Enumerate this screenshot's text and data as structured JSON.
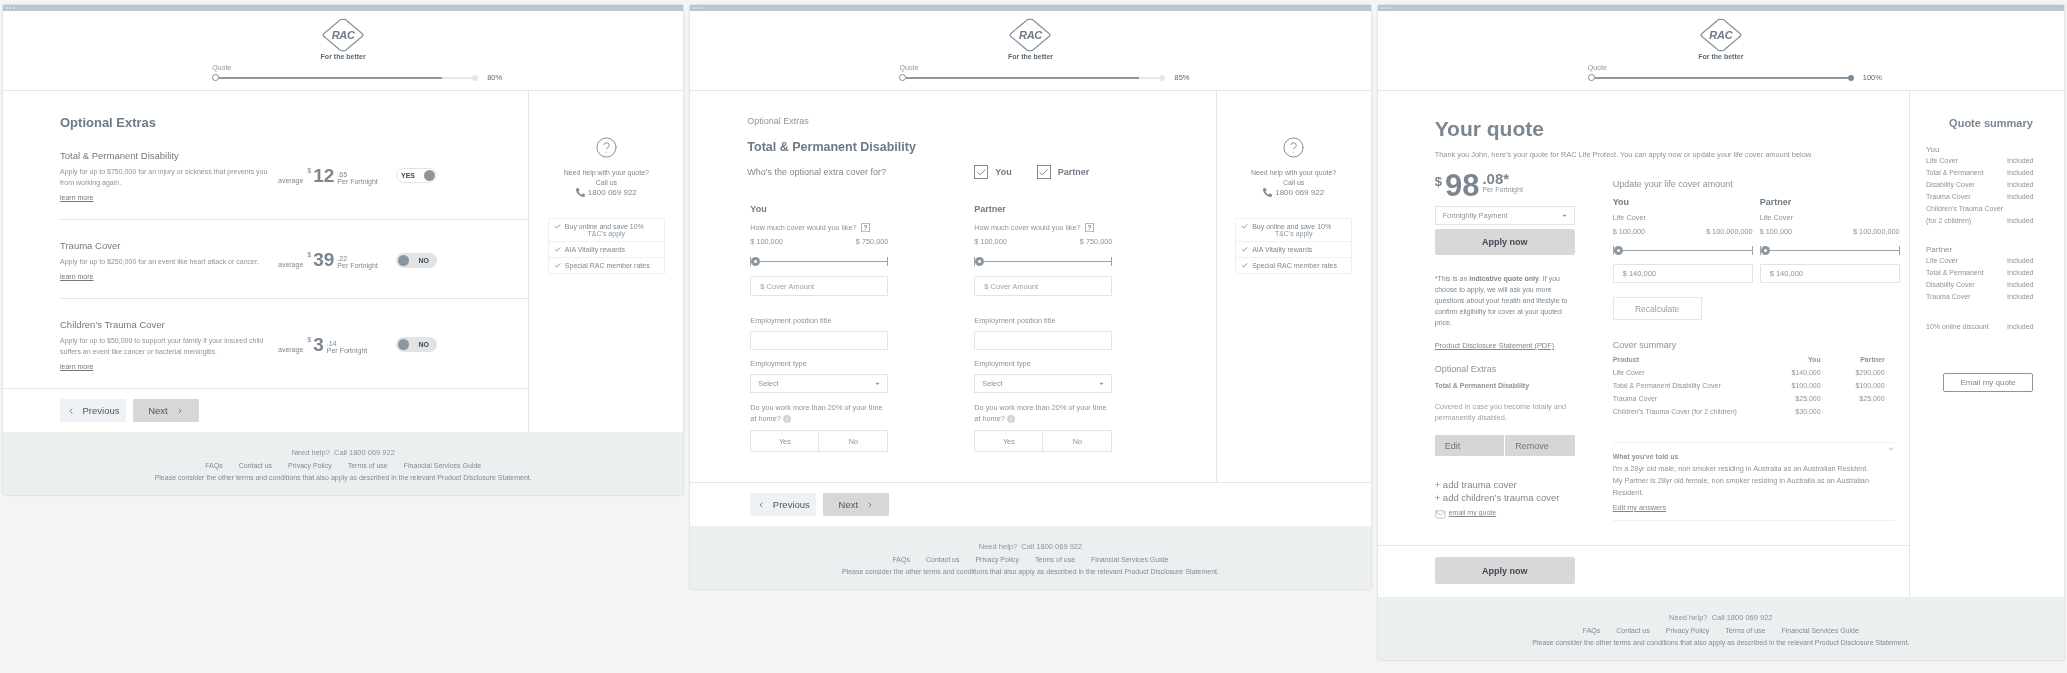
{
  "panels": [
    {
      "kind": "extras_list",
      "logo": {
        "mark": "RAC",
        "tagline": "For the better"
      },
      "progress": {
        "label": "Quote",
        "level": 0.88,
        "reading": "80%"
      },
      "title": "Optional Extras",
      "extras": [
        {
          "name": "Total & Permanent Disability",
          "description": "Apply for up to $750,000 for an injury or sickness that prevents you from working again.",
          "link": "learn more",
          "average": "average",
          "currency": "$",
          "dollars": "12",
          "cents": ".65",
          "period": "Per Fortnight",
          "toggle": "YES",
          "on": true
        },
        {
          "name": "Trauma Cover",
          "description": "Apply for up to $250,000 for an event like heart attack or cancer.",
          "link": "learn more",
          "average": "average",
          "currency": "$",
          "dollars": "39",
          "cents": ".22",
          "period": "Per Fortnight",
          "toggle": "NO",
          "on": false
        },
        {
          "name": "Children's Trauma Cover",
          "description": "Apply for up to $50,000 to support your family if your insured child suffers an event like cancer or bacterial meningitis.",
          "link": "learn more",
          "average": "average",
          "currency": "$",
          "dollars": "3",
          "cents": ".14",
          "period": "Per Fortnight",
          "toggle": "NO",
          "on": false
        }
      ],
      "nav": {
        "previous": "Previous",
        "next": "Next"
      },
      "help": {
        "question": "Need help with your quote?",
        "call": "Call us",
        "phone": "1800 069 922",
        "benefits": [
          {
            "text": "Buy online and save 10%",
            "note": "T&C's apply"
          },
          {
            "text": "AIA Vitality rewards"
          },
          {
            "text": "Special RAC member rates"
          }
        ]
      },
      "footer": {
        "help": "Need help?  Call 1800 069 922",
        "links": [
          "FAQs",
          "Contact us",
          "Privacy Policy",
          "Terms of use",
          "Financial Services Guide"
        ],
        "disclaimer": "Please consider the other terms and conditions that also apply as described in the relevant Product Disclosure Statement."
      }
    },
    {
      "kind": "extras_form",
      "logo": {
        "mark": "RAC",
        "tagline": "For the better"
      },
      "progress": {
        "label": "Quote",
        "level": 0.92,
        "reading": "85%"
      },
      "section": "Optional Extras",
      "title": "Total & Permanent Disability",
      "question": "Who's the optional extra cover for?",
      "covered": [
        {
          "label": "You",
          "checked": true
        },
        {
          "label": "Partner",
          "checked": true
        }
      ],
      "people": [
        {
          "heading": "You",
          "cover_question": "How much cover would you like?",
          "min": "$ 100,000",
          "max": "$ 750,000",
          "level": 0,
          "amount_placeholder": "$ Cover Amount",
          "position_label": "Employment position title",
          "type_label": "Employment type",
          "type_placeholder": "Select",
          "home_question": "Do you work more than 20% of your time at home?",
          "options": [
            {
              "label": "Yes",
              "selected": false
            },
            {
              "label": "No",
              "selected": false
            }
          ]
        },
        {
          "heading": "Partner",
          "cover_question": "How much cover would you like?",
          "min": "$ 100,000",
          "max": "$ 750,000",
          "level": 0,
          "amount_placeholder": "$ Cover Amount",
          "position_label": "Employment position title",
          "type_label": "Employment type",
          "type_placeholder": "Select",
          "home_question": "Do you work more than 20% of your time at home?",
          "options": [
            {
              "label": "Yes",
              "selected": false
            },
            {
              "label": "No",
              "selected": false
            }
          ]
        }
      ],
      "nav": {
        "previous": "Previous",
        "next": "Next"
      },
      "help": {
        "question": "Need help with your quote?",
        "call": "Call us",
        "phone": "1800 069 922",
        "benefits": [
          {
            "text": "Buy online and save 10%",
            "note": "T&C's apply"
          },
          {
            "text": "AIA Vitality rewards"
          },
          {
            "text": "Special RAC member rates"
          }
        ]
      },
      "footer": {
        "help": "Need help?  Call 1800 069 922",
        "links": [
          "FAQs",
          "Contact us",
          "Privacy Policy",
          "Terms of use",
          "Financial Services Guide"
        ],
        "disclaimer": "Please consider the other terms and conditions that also apply as described in the relevant Product Disclosure Statement."
      }
    },
    {
      "kind": "quote",
      "logo": {
        "mark": "RAC",
        "tagline": "For the better"
      },
      "progress": {
        "label": "Quote",
        "level": 1,
        "reading": "100%"
      },
      "title": "Your quote",
      "intro": "Thank you John, here's your quote for RAC Life Protect. You can apply now or update your life cover amount below.",
      "price": {
        "currency": "$",
        "dollars": "98",
        "cents": ".08*",
        "period": "Per Fortnight"
      },
      "frequency": "Fortnightly Payment",
      "apply": "Apply now",
      "disclaimer": "*This is an **indicative quote only**. If you choose to apply, we will ask you more questions about your health and lifestyle to confirm eligibility for cover at your quoted price.",
      "pds_link": "Product Disclosure Statement (PDF)",
      "extras_heading": "Optional Extras",
      "extra": {
        "name": "Total & Permanent Disability",
        "description": "Covered in case you become totally and permanently disabled.",
        "edit": "Edit",
        "remove": "Remove"
      },
      "add_links": [
        "+ add trauma cover",
        "+ add children’s trauma cover"
      ],
      "email_link": "email my quote",
      "update": {
        "heading": "Update your life cover amount",
        "people": [
          {
            "heading": "You",
            "label": "Life Cover",
            "min": "$ 100,000",
            "max": "$ 100,000,000",
            "level": 0,
            "value": "$ 140,000"
          },
          {
            "heading": "Partner",
            "label": "Life Cover",
            "min": "$ 100,000",
            "max": "$ 100,000,000",
            "level": 0,
            "value": "$ 140,000"
          }
        ]
      },
      "recalculate": {
        "label": "Recalculate",
        "disabled": true
      },
      "cover_summary": {
        "heading": "Cover summary",
        "columns": [
          "Product",
          "You",
          "Partner"
        ],
        "rows": [
          [
            "Life Cover",
            "$140,000",
            "$290,000"
          ],
          [
            "Total & Permanent Disability Cover",
            "$100,000",
            "$100,000"
          ],
          [
            "Trauma Cover",
            "$25,000",
            "$25,000"
          ],
          [
            "Children's Trauma Cover (for 2 children)",
            "$30,000"
          ]
        ]
      },
      "told_us": {
        "heading": "What you've told us",
        "lines": [
          "I'm a 28yr old male, non smoker residing in Australia as an Australian Resident.",
          "My Partner is 28yr old female, non smoker residing in Australia as an Australian Resident."
        ],
        "link": "Edit my answers"
      },
      "apply_bottom": "Apply now",
      "summary": {
        "title": "Quote summary",
        "groups": [
          {
            "heading": "You",
            "items": [
              {
                "name": "Life Cover",
                "status": "Included"
              },
              {
                "name": "Total & Permanent",
                "status": "Included"
              },
              {
                "name": "Disability Cover",
                "status": "Included"
              },
              {
                "name": "Trauma Cover",
                "status": "Included"
              },
              {
                "name": "Children's Trauma Cover (for 2 children)",
                "status": "Included"
              }
            ]
          },
          {
            "heading": "Partner",
            "items": [
              {
                "name": "Life Cover",
                "status": "Included"
              },
              {
                "name": "Total & Permanent",
                "status": "Included"
              },
              {
                "name": "Disability Cover",
                "status": "Included"
              },
              {
                "name": "Trauma Cover",
                "status": "Included"
              }
            ]
          },
          {
            "items": [
              {
                "name": "10% online discount",
                "status": "Included"
              }
            ]
          }
        ],
        "email": "Email my quote"
      },
      "footer": {
        "help": "Need help?  Call 1800 069 922",
        "links": [
          "FAQs",
          "Contact us",
          "Privacy Policy",
          "Terms of use",
          "Financial Services Guide"
        ],
        "disclaimer": "Please consider the other terms and conditions that also apply as described in the relevant Product Disclosure Statement."
      }
    }
  ]
}
